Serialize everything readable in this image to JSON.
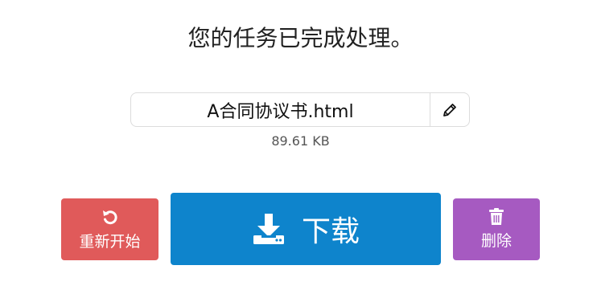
{
  "header": {
    "title": "您的任务已完成处理。"
  },
  "file": {
    "name": "A合同协议书.html",
    "size": "89.61 KB",
    "edit_icon": "pencil-icon"
  },
  "actions": {
    "restart_label": "重新开始",
    "restart_icon": "undo-icon",
    "download_label": "下载",
    "download_icon": "download-icon",
    "delete_label": "删除",
    "delete_icon": "trash-icon"
  },
  "colors": {
    "restart": "#e05a5a",
    "download": "#0e84cc",
    "delete": "#a65ac1"
  }
}
